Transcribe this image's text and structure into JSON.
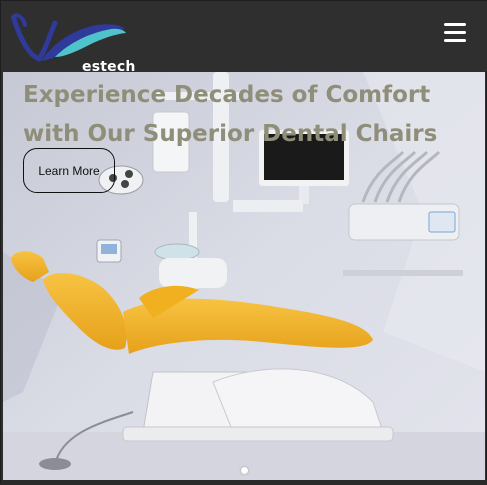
{
  "brand": {
    "name": "estech"
  },
  "header": {
    "menu_icon": "hamburger-menu-icon"
  },
  "hero": {
    "headline": "Experience Decades of Comfort with Our Superior Dental Chairs",
    "cta_label": "Learn More",
    "slides_count": 1,
    "active_slide": 1
  },
  "colors": {
    "header_bg": "#2f2f2f",
    "headline": "#8f8e79",
    "chair_upholstery": "#f2b21c",
    "logo_blue": "#2f3a9a",
    "logo_teal": "#4ec3c9"
  }
}
